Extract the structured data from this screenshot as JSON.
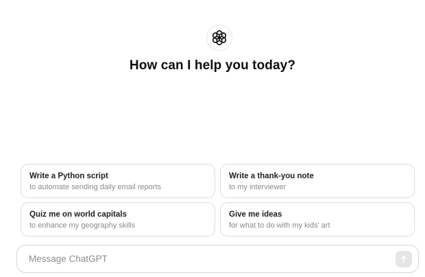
{
  "logo": {
    "icon": "openai-logo-icon"
  },
  "headline": "How can I help you today?",
  "suggestions": [
    {
      "title": "Write a Python script",
      "subtitle": "to automate sending daily email reports"
    },
    {
      "title": "Write a thank-you note",
      "subtitle": "to my interviewer"
    },
    {
      "title": "Quiz me on world capitals",
      "subtitle": "to enhance my geography skills"
    },
    {
      "title": "Give me ideas",
      "subtitle": "for what to do with my kids' art"
    }
  ],
  "composer": {
    "placeholder": "Message ChatGPT",
    "value": "",
    "send_icon": "arrow-up-icon"
  },
  "colors": {
    "text": "#0d0d0d",
    "muted": "#8a8a8a",
    "border": "#dcdcdc",
    "send_disabled": "#e5e5e5"
  }
}
